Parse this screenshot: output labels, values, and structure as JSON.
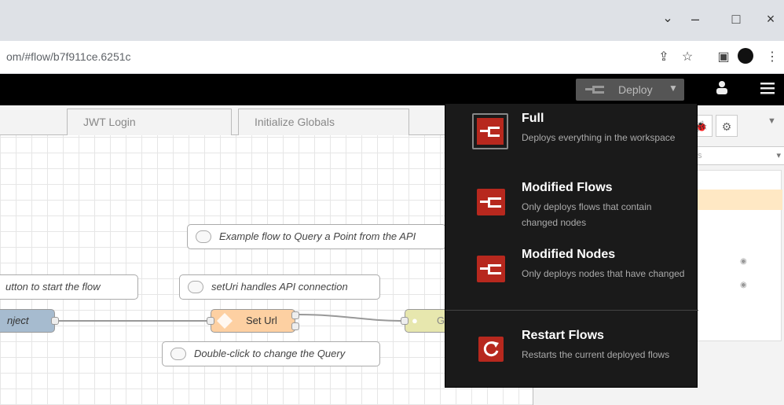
{
  "browser": {
    "url": "om/#flow/b7f911ce.6251c",
    "window_controls": [
      "minimize",
      "maximize",
      "close"
    ]
  },
  "header": {
    "deploy_label": "Deploy"
  },
  "tabs": [
    {
      "label": "JWT Login"
    },
    {
      "label": "Initialize Globals"
    }
  ],
  "comments": {
    "example": "Example flow to Query a Point from the API",
    "button": "utton to start the flow",
    "seturl": "setUri handles API connection",
    "doubleclick": "Double-click to change the Query"
  },
  "nodes": {
    "inject": "nject",
    "seturl": "Set Url",
    "get": "G"
  },
  "sidebar": {
    "search_hint": "ws"
  },
  "deploy_menu": {
    "items": [
      {
        "title": "Full",
        "desc": "Deploys everything in the workspace",
        "icon": "deploy-full-icon"
      },
      {
        "title": "Modified Flows",
        "desc": "Only deploys flows that contain changed nodes",
        "icon": "deploy-flows-icon"
      },
      {
        "title": "Modified Nodes",
        "desc": "Only deploys nodes that have changed",
        "icon": "deploy-nodes-icon"
      },
      {
        "title": "Restart Flows",
        "desc": "Restarts the current deployed flows",
        "icon": "restart-icon"
      }
    ]
  },
  "colors": {
    "accent_red": "#b7281e",
    "inject_node": "#a6bbcf",
    "function_node": "#fdd0a2",
    "http_node": "#e7e7ae"
  }
}
